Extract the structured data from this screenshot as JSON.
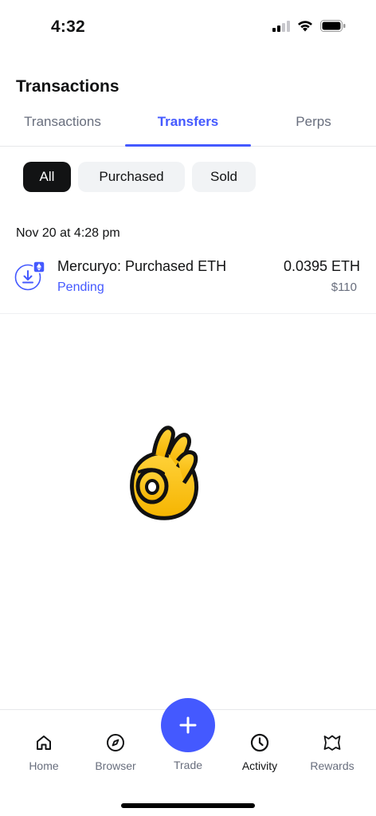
{
  "status_bar": {
    "time": "4:32",
    "icons": [
      "signal-icon",
      "wifi-icon",
      "battery-icon"
    ]
  },
  "page": {
    "title": "Transactions"
  },
  "tabs": [
    {
      "label": "Transactions",
      "active": false
    },
    {
      "label": "Transfers",
      "active": true
    },
    {
      "label": "Perps",
      "active": false
    }
  ],
  "filters": [
    {
      "label": "All",
      "active": true
    },
    {
      "label": "Purchased",
      "active": false
    },
    {
      "label": "Sold",
      "active": false
    }
  ],
  "transactions": {
    "date": "Nov 20 at 4:28 pm",
    "item": {
      "icon": "receive-download-icon",
      "badge": "eth-icon",
      "title": "Mercuryo: Purchased ETH",
      "status": "Pending",
      "amount": "0.0395 ETH",
      "fiat": "$110"
    }
  },
  "overlay": {
    "emoji": "ok-hand-emoji"
  },
  "bottom_nav": {
    "items": [
      {
        "label": "Home",
        "icon": "home-icon"
      },
      {
        "label": "Browser",
        "icon": "compass-icon"
      },
      {
        "label": "Trade",
        "icon": "plus-icon"
      },
      {
        "label": "Activity",
        "icon": "clock-icon",
        "active": true
      },
      {
        "label": "Rewards",
        "icon": "rewards-icon"
      }
    ]
  },
  "colors": {
    "accent": "#4459ff",
    "text": "#121314",
    "muted": "#686e7d",
    "chip_bg": "#f1f3f5"
  }
}
